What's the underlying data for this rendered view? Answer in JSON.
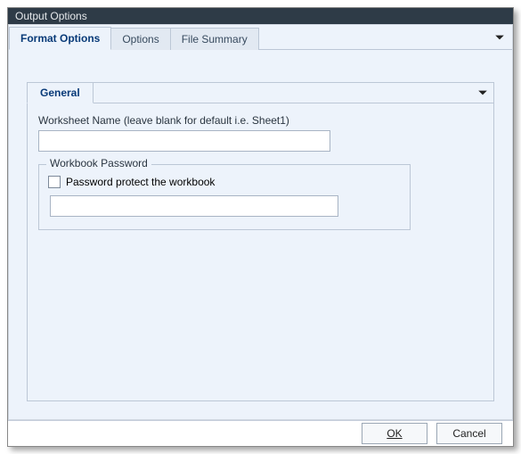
{
  "window": {
    "title": "Output Options"
  },
  "outer_tabs": {
    "items": [
      {
        "label": "Format Options"
      },
      {
        "label": "Options"
      },
      {
        "label": "File Summary"
      }
    ]
  },
  "inner_tabs": {
    "items": [
      {
        "label": "General"
      }
    ]
  },
  "general": {
    "worksheet_label": "Worksheet Name (leave blank for default i.e.  Sheet1)",
    "worksheet_value": "",
    "password_group_legend": "Workbook Password",
    "password_checkbox_label": "Password protect  the workbook",
    "password_checked": false,
    "password_value": ""
  },
  "footer": {
    "ok_label": "OK",
    "cancel_label": "Cancel"
  }
}
